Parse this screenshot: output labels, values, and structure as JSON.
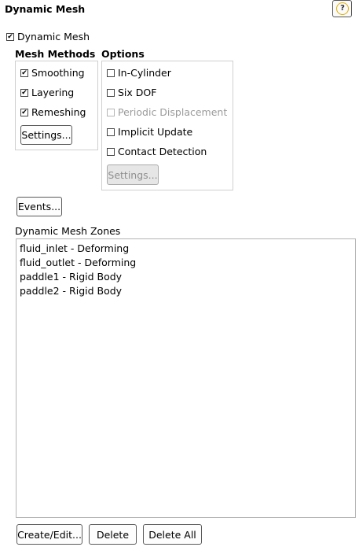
{
  "panel": {
    "title": "Dynamic Mesh",
    "help_icon": "question-mark-icon",
    "help_glyph": "?"
  },
  "dynamic_mesh_checkbox": {
    "label": "Dynamic Mesh",
    "checked": true
  },
  "mesh_methods": {
    "title": "Mesh Methods",
    "items": [
      {
        "label": "Smoothing",
        "checked": true
      },
      {
        "label": "Layering",
        "checked": true
      },
      {
        "label": "Remeshing",
        "checked": true
      }
    ],
    "settings_button": "Settings..."
  },
  "options": {
    "title": "Options",
    "items": [
      {
        "label": "In-Cylinder",
        "checked": false,
        "enabled": true
      },
      {
        "label": "Six DOF",
        "checked": false,
        "enabled": true
      },
      {
        "label": "Periodic Displacement",
        "checked": false,
        "enabled": false
      },
      {
        "label": "Implicit Update",
        "checked": false,
        "enabled": true
      },
      {
        "label": "Contact Detection",
        "checked": false,
        "enabled": true
      }
    ],
    "settings_button": "Settings..."
  },
  "events_button": "Events...",
  "zones": {
    "title": "Dynamic Mesh Zones",
    "items": [
      "fluid_inlet - Deforming",
      "fluid_outlet - Deforming",
      "paddle1 - Rigid Body",
      "paddle2 - Rigid Body"
    ]
  },
  "bottom_buttons": {
    "create_edit": "Create/Edit...",
    "delete": "Delete",
    "delete_all": "Delete All"
  },
  "check_glyph": "✔"
}
